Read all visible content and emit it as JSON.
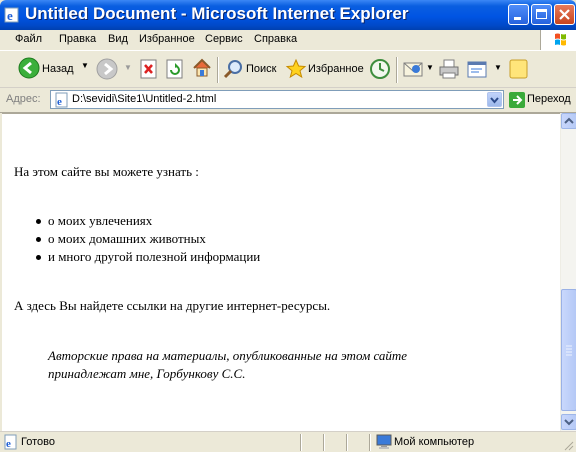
{
  "window": {
    "title": "Untitled Document - Microsoft Internet Explorer"
  },
  "menu": {
    "items": [
      "Файл",
      "Правка",
      "Вид",
      "Избранное",
      "Сервис",
      "Справка"
    ]
  },
  "toolbar": {
    "back_label": "Назад",
    "search_label": "Поиск",
    "favorites_label": "Избранное"
  },
  "address": {
    "label": "Адрес:",
    "value": "D:\\sevidi\\Site1\\Untitled-2.html",
    "go_label": "Переход"
  },
  "content": {
    "intro": "На этом сайте вы можете узнать :",
    "list": [
      "о моих увлечениях",
      "о моих домашних животных",
      "и много другой полезной информации"
    ],
    "links_text": "А здесь Вы найдете ссылки на другие интернет-ресурсы.",
    "copyright": "Авторские права на материалы, опубликованные на этом сайте принадлежат мне, Горбункову С.С."
  },
  "status": {
    "text": "Готово",
    "zone": "Мой компьютер"
  },
  "colors": {
    "titlebar": "#0054E3",
    "chrome": "#ECE9D8",
    "close_button": "#C7441E"
  }
}
